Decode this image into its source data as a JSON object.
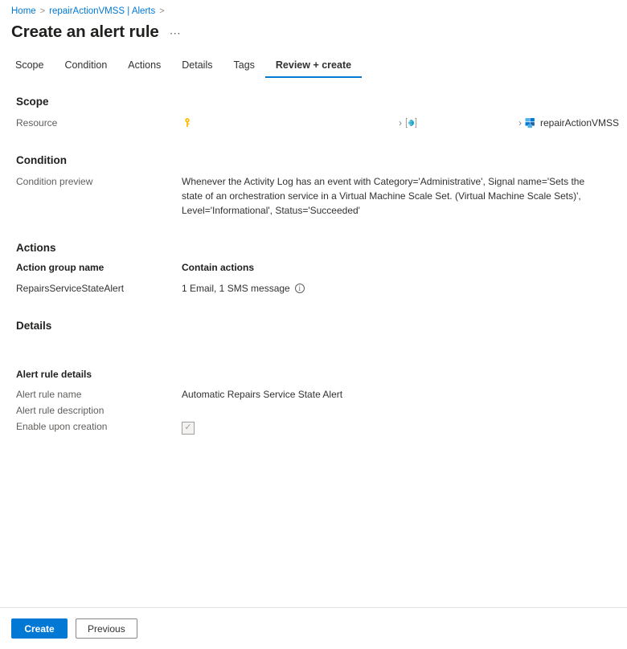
{
  "breadcrumb": {
    "items": [
      {
        "label": "Home"
      },
      {
        "label": "repairActionVMSS | Alerts"
      }
    ],
    "separator": ">"
  },
  "header": {
    "title": "Create an alert rule",
    "more_label": "⋯"
  },
  "tabs": [
    {
      "label": "Scope",
      "active": false
    },
    {
      "label": "Condition",
      "active": false
    },
    {
      "label": "Actions",
      "active": false
    },
    {
      "label": "Details",
      "active": false
    },
    {
      "label": "Tags",
      "active": false
    },
    {
      "label": "Review + create",
      "active": true
    }
  ],
  "scope": {
    "heading": "Scope",
    "resource_label": "Resource",
    "path": [
      {
        "icon": "key-icon",
        "name": ""
      },
      {
        "icon": "resource-group-icon",
        "name": ""
      },
      {
        "icon": "vmss-icon",
        "name": "repairActionVMSS"
      }
    ],
    "separator": "›"
  },
  "condition": {
    "heading": "Condition",
    "preview_label": "Condition preview",
    "preview_text": "Whenever the Activity Log has an event with Category='Administrative', Signal name='Sets the state of an orchestration service in a Virtual Machine Scale Set. (Virtual Machine Scale Sets)', Level='Informational', Status='Succeeded'"
  },
  "actions": {
    "heading": "Actions",
    "columns": [
      "Action group name",
      "Contain actions"
    ],
    "rows": [
      {
        "group_name": "RepairsServiceStateAlert",
        "contains": "1 Email, 1 SMS message"
      }
    ],
    "info_glyph": "i"
  },
  "details": {
    "heading": "Details",
    "subheading": "Alert rule details",
    "fields": [
      {
        "label": "Alert rule name",
        "value": "Automatic Repairs Service State Alert"
      },
      {
        "label": "Alert rule description",
        "value": ""
      }
    ],
    "enable_label": "Enable upon creation",
    "enable_checked": true,
    "check_glyph": "✓"
  },
  "footer": {
    "create_label": "Create",
    "previous_label": "Previous"
  },
  "colors": {
    "accent": "#0078d4",
    "link": "#0078d4",
    "text": "#323130",
    "muted": "#605e5c",
    "key_icon": "#ffb900",
    "rg_icon": "#32bedd",
    "vmss_icon": "#0078d4"
  }
}
